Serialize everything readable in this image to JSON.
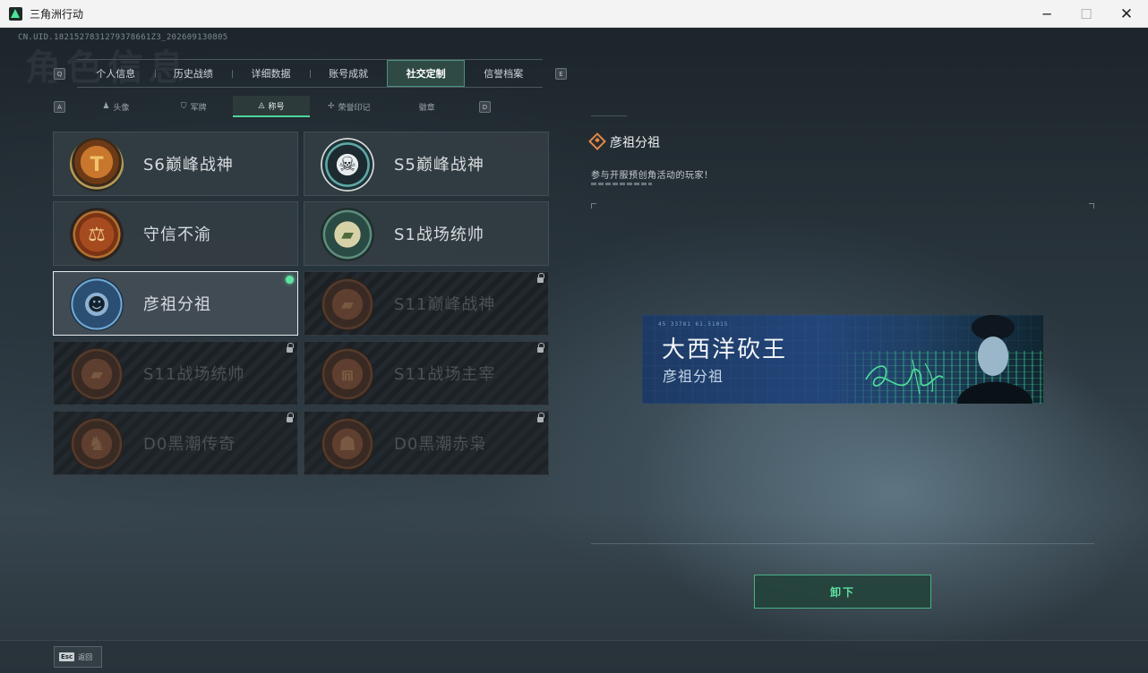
{
  "window": {
    "title": "三角洲行动",
    "minimize": "─",
    "maximize": "☐",
    "close": "✕"
  },
  "uid": "CN.UID.1821527831279378661Z3_202609130805",
  "bg_title": "角色信息",
  "tabs": {
    "prev_key": "Q",
    "next_key": "E",
    "items": [
      {
        "label": "个人信息"
      },
      {
        "label": "历史战绩"
      },
      {
        "label": "详细数据"
      },
      {
        "label": "账号成就"
      },
      {
        "label": "社交定制",
        "active": true
      },
      {
        "label": "信誉档案"
      }
    ]
  },
  "subtabs": {
    "prev_key": "A",
    "next_key": "D",
    "items": [
      {
        "label": "头像",
        "icon": "person-icon"
      },
      {
        "label": "军牌",
        "icon": "dogtag-icon"
      },
      {
        "label": "称号",
        "icon": "title-icon",
        "active": true
      },
      {
        "label": "荣誉印记",
        "icon": "honor-icon"
      },
      {
        "label": "徽章",
        "icon": "badge-icon"
      }
    ]
  },
  "titles": [
    {
      "label": "S6巅峰战神",
      "locked": false,
      "badge": "gold-shield"
    },
    {
      "label": "S5巅峰战神",
      "locked": false,
      "badge": "skull-ski"
    },
    {
      "label": "守信不渝",
      "locked": false,
      "badge": "scales"
    },
    {
      "label": "S1战场统帅",
      "locked": false,
      "badge": "tank-green"
    },
    {
      "label": "彦祖分祖",
      "locked": false,
      "badge": "portrait",
      "selected": true,
      "equipped": true
    },
    {
      "label": "S11巅峰战神",
      "locked": true,
      "badge": "tank-bronze"
    },
    {
      "label": "S11战场统帅",
      "locked": true,
      "badge": "tank-bronze-2"
    },
    {
      "label": "S11战场主宰",
      "locked": true,
      "badge": "arch-bronze"
    },
    {
      "label": "D0黑潮传奇",
      "locked": true,
      "badge": "soldier-bronze"
    },
    {
      "label": "D0黑潮赤枭",
      "locked": true,
      "badge": "mask-bronze"
    }
  ],
  "detail": {
    "name": "彦祖分祖",
    "description": "参与开服预创角活动的玩家！"
  },
  "nameplate": {
    "code": "45 33781   61.51015",
    "main": "大西洋砍王",
    "sub": "彦祖分祖"
  },
  "actions": {
    "unequip": "卸下"
  },
  "footer": {
    "esc_key": "Esc",
    "back": "返回"
  },
  "colors": {
    "accent": "#5fe3a2",
    "detail_icon": "#e08a4a"
  }
}
